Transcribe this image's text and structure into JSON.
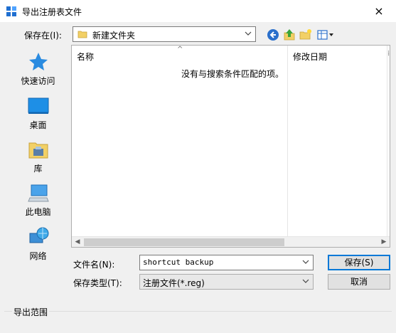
{
  "window": {
    "title": "导出注册表文件",
    "close": "×"
  },
  "save_in": {
    "label": "保存在(I):",
    "value": "新建文件夹"
  },
  "places": [
    {
      "label": "快速访问",
      "icon": "star-icon"
    },
    {
      "label": "桌面",
      "icon": "desktop-icon"
    },
    {
      "label": "库",
      "icon": "library-icon"
    },
    {
      "label": "此电脑",
      "icon": "computer-icon"
    },
    {
      "label": "网络",
      "icon": "network-icon"
    }
  ],
  "file_list": {
    "columns": [
      "名称",
      "修改日期"
    ],
    "empty_message": "没有与搜索条件匹配的项。"
  },
  "filename": {
    "label": "文件名(N):",
    "value": "shortcut backup"
  },
  "filetype": {
    "label": "保存类型(T):",
    "value": "注册文件(*.reg)"
  },
  "buttons": {
    "save": "保存(S)",
    "cancel": "取消"
  },
  "export_range": {
    "label": "导出范围"
  }
}
